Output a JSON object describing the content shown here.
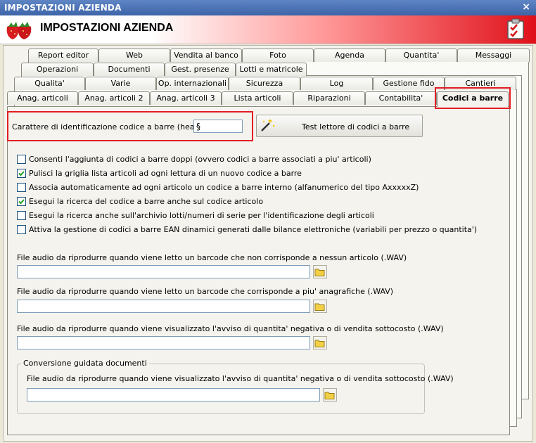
{
  "window": {
    "title": "IMPOSTAZIONI AZIENDA",
    "close": "×"
  },
  "header": {
    "title": "IMPOSTAZIONI AZIENDA"
  },
  "tabs": {
    "row1": [
      "Report editor",
      "Web",
      "Vendita al banco",
      "Foto",
      "Agenda",
      "Quantita'",
      "Messaggi"
    ],
    "row2": [
      "Operazioni",
      "Documenti",
      "Gest. presenze",
      "Lotti e matricole"
    ],
    "row3": [
      "Qualita'",
      "Varie",
      "Op. internazionali",
      "Sicurezza",
      "Log",
      "Gestione fido",
      "Cantieri"
    ],
    "row4": [
      "Anag. articoli",
      "Anag. articoli 2",
      "Anag. articoli 3",
      "Lista articoli",
      "Riparazioni",
      "Contabilita'",
      "Codici a barre"
    ]
  },
  "header_char": {
    "label": "Carattere di identificazione codice a barre (header) :",
    "value": "§"
  },
  "test_button": {
    "label": "Test lettore di codici a barre",
    "icon": "magic-wand-icon"
  },
  "options": [
    {
      "label": "Consenti l'aggiunta di codici a barre doppi (ovvero codici a barre associati a piu' articoli)",
      "checked": false
    },
    {
      "label": "Pulisci la griglia lista articoli ad ogni lettura di un nuovo codice a barre",
      "checked": true
    },
    {
      "label": "Associa automaticamente ad ogni articolo un codice a barre interno (alfanumerico del tipo AxxxxxZ)",
      "checked": false
    },
    {
      "label": "Esegui la ricerca del codice a barre anche sul codice articolo",
      "checked": true
    },
    {
      "label": "Esegui la ricerca anche sull'archivio lotti/numeri di serie per l'identificazione degli articoli",
      "checked": false
    },
    {
      "label": "Attiva la gestione di codici a barre EAN dinamici generati dalle bilance elettroniche (variabili per prezzo o quantita')",
      "checked": false
    }
  ],
  "audio": [
    {
      "label": "File audio da riprodurre quando viene letto un barcode che non corrisponde a nessun articolo (.WAV)",
      "value": ""
    },
    {
      "label": "File audio da riprodurre quando viene letto un barcode che corrisponde a piu' anagrafiche (.WAV)",
      "value": ""
    },
    {
      "label": "File audio da riprodurre quando viene visualizzato l'avviso di quantita' negativa o di vendita sottocosto (.WAV)",
      "value": ""
    }
  ],
  "conversion": {
    "legend": "Conversione guidata documenti",
    "label": "File audio da riprodurre quando viene visualizzato l'avviso di quantita' negativa o di vendita sottocosto (.WAV)",
    "value": ""
  },
  "colors": {
    "highlight": "#e31d24",
    "title_bar": "#4a72b5",
    "header_gradient_end": "#e0101a"
  }
}
